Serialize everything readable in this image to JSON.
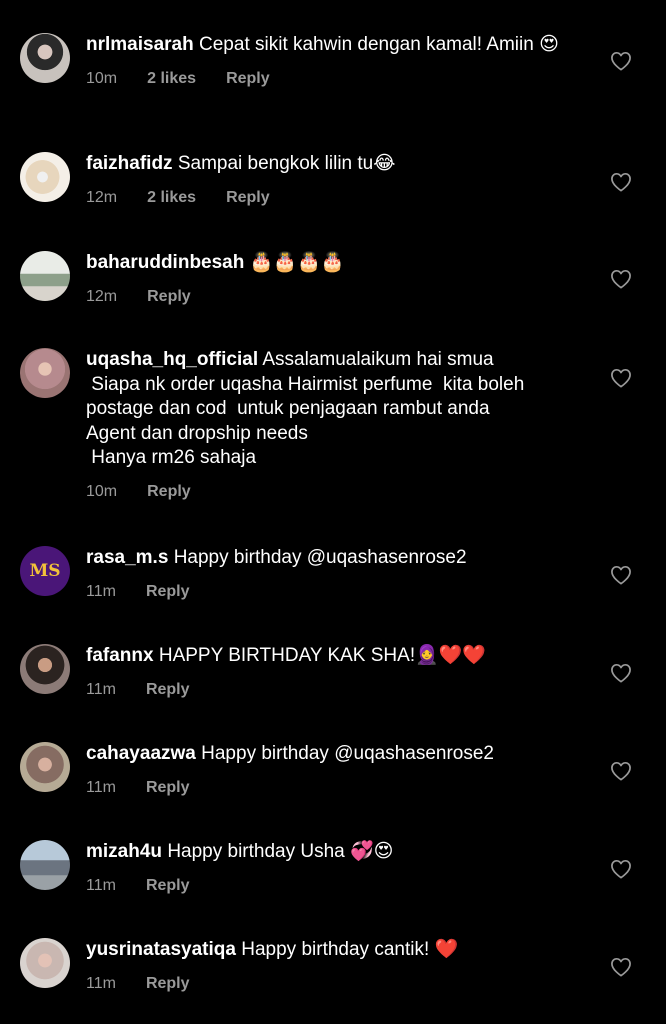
{
  "comments": [
    {
      "username": "nrlmaisarah",
      "text": "Cepat sikit kahwin dengan kamal! Amiin 😍",
      "time": "10m",
      "likes": "2 likes",
      "reply": "Reply",
      "avatar": "avatar-photo"
    },
    {
      "username": "faizhafidz",
      "text": "Sampai bengkok lilin tu😂",
      "time": "12m",
      "likes": "2 likes",
      "reply": "Reply",
      "avatar": "avatar-photo"
    },
    {
      "username": "baharuddinbesah",
      "text": "🎂🎂🎂🎂",
      "time": "12m",
      "likes": "",
      "reply": "Reply",
      "avatar": "avatar-photo"
    },
    {
      "username": "uqasha_hq_official",
      "text": "Assalamualaikum hai smua\n Siapa nk order uqasha Hairmist perfume  kita boleh postage dan cod  untuk penjagaan rambut anda\nAgent dan dropship needs\n Hanya rm26 sahaja",
      "time": "10m",
      "likes": "",
      "reply": "Reply",
      "avatar": "avatar-photo"
    },
    {
      "username": "rasa_m.s",
      "text": "Happy birthday @uqashasenrose2",
      "time": "11m",
      "likes": "",
      "reply": "Reply",
      "avatar": "avatar-initials",
      "avatar_text": "MS"
    },
    {
      "username": "fafannx",
      "text": "HAPPY BIRTHDAY KAK SHA!🧕❤️❤️",
      "time": "11m",
      "likes": "",
      "reply": "Reply",
      "avatar": "avatar-photo"
    },
    {
      "username": "cahayaazwa",
      "text": "Happy birthday @uqashasenrose2",
      "time": "11m",
      "likes": "",
      "reply": "Reply",
      "avatar": "avatar-photo"
    },
    {
      "username": "mizah4u",
      "text": "Happy birthday Usha 💞😍",
      "time": "11m",
      "likes": "",
      "reply": "Reply",
      "avatar": "avatar-photo"
    },
    {
      "username": "yusrinatasyatiqa",
      "text": "Happy birthday cantik! ❤️",
      "time": "11m",
      "likes": "",
      "reply": "Reply",
      "avatar": "avatar-photo"
    }
  ],
  "colors": {
    "background": "#000000",
    "text": "#ffffff",
    "meta": "#9a9a9a",
    "heart": "#9a9a9a",
    "ms_avatar_bg": "#4a1678"
  }
}
